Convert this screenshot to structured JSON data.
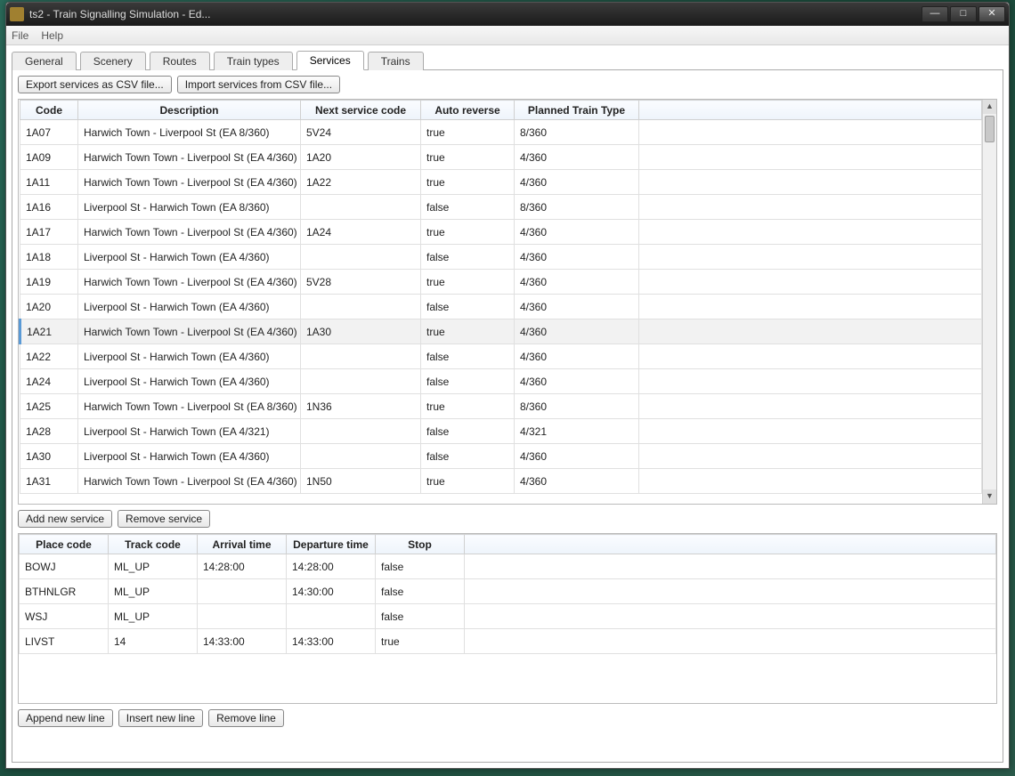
{
  "window_title": "ts2 - Train Signalling Simulation - Ed...",
  "menu": {
    "file": "File",
    "help": "Help"
  },
  "tabs": [
    "General",
    "Scenery",
    "Routes",
    "Train types",
    "Services",
    "Trains"
  ],
  "active_tab_index": 4,
  "buttons": {
    "export_csv": "Export services as CSV file...",
    "import_csv": "Import services from CSV file...",
    "add_service": "Add new service",
    "remove_service": "Remove service",
    "append_line": "Append new line",
    "insert_line": "Insert new line",
    "remove_line": "Remove line"
  },
  "services_table": {
    "headers": [
      "Code",
      "Description",
      "Next service code",
      "Auto reverse",
      "Planned Train Type"
    ],
    "selected_index": 8,
    "rows": [
      {
        "code": "1A07",
        "desc": "Harwich Town - Liverpool St (EA 8/360)",
        "next": "5V24",
        "auto": "true",
        "type": "8/360"
      },
      {
        "code": "1A09",
        "desc": "Harwich Town Town - Liverpool St (EA 4/360)",
        "next": "1A20",
        "auto": "true",
        "type": "4/360"
      },
      {
        "code": "1A11",
        "desc": "Harwich Town Town - Liverpool St (EA 4/360)",
        "next": "1A22",
        "auto": "true",
        "type": "4/360"
      },
      {
        "code": "1A16",
        "desc": "Liverpool St - Harwich Town (EA 8/360)",
        "next": "",
        "auto": "false",
        "type": "8/360"
      },
      {
        "code": "1A17",
        "desc": "Harwich Town Town - Liverpool St (EA 4/360)",
        "next": "1A24",
        "auto": "true",
        "type": "4/360"
      },
      {
        "code": "1A18",
        "desc": "Liverpool St - Harwich Town (EA 4/360)",
        "next": "",
        "auto": "false",
        "type": "4/360"
      },
      {
        "code": "1A19",
        "desc": "Harwich Town Town - Liverpool St (EA 4/360)",
        "next": "5V28",
        "auto": "true",
        "type": "4/360"
      },
      {
        "code": "1A20",
        "desc": "Liverpool St - Harwich Town (EA 4/360)",
        "next": "",
        "auto": "false",
        "type": "4/360"
      },
      {
        "code": "1A21",
        "desc": "Harwich Town Town - Liverpool St (EA 4/360)",
        "next": "1A30",
        "auto": "true",
        "type": "4/360"
      },
      {
        "code": "1A22",
        "desc": "Liverpool St - Harwich Town (EA 4/360)",
        "next": "",
        "auto": "false",
        "type": "4/360"
      },
      {
        "code": "1A24",
        "desc": "Liverpool St - Harwich Town (EA 4/360)",
        "next": "",
        "auto": "false",
        "type": "4/360"
      },
      {
        "code": "1A25",
        "desc": "Harwich Town Town - Liverpool St (EA 8/360)",
        "next": "1N36",
        "auto": "true",
        "type": "8/360"
      },
      {
        "code": "1A28",
        "desc": "Liverpool St - Harwich Town (EA 4/321)",
        "next": "",
        "auto": "false",
        "type": "4/321"
      },
      {
        "code": "1A30",
        "desc": "Liverpool St - Harwich Town (EA 4/360)",
        "next": "",
        "auto": "false",
        "type": "4/360"
      },
      {
        "code": "1A31",
        "desc": "Harwich Town Town - Liverpool St (EA 4/360)",
        "next": "1N50",
        "auto": "true",
        "type": "4/360"
      }
    ]
  },
  "detail_table": {
    "headers": [
      "Place code",
      "Track code",
      "Arrival time",
      "Departure time",
      "Stop"
    ],
    "rows": [
      {
        "place": "BOWJ",
        "track": "ML_UP",
        "arr": "14:28:00",
        "dep": "14:28:00",
        "stop": "false"
      },
      {
        "place": "BTHNLGR",
        "track": "ML_UP",
        "arr": "",
        "dep": "14:30:00",
        "stop": "false"
      },
      {
        "place": "WSJ",
        "track": "ML_UP",
        "arr": "",
        "dep": "",
        "stop": "false"
      },
      {
        "place": "LIVST",
        "track": "14",
        "arr": "14:33:00",
        "dep": "14:33:00",
        "stop": "true"
      }
    ]
  }
}
